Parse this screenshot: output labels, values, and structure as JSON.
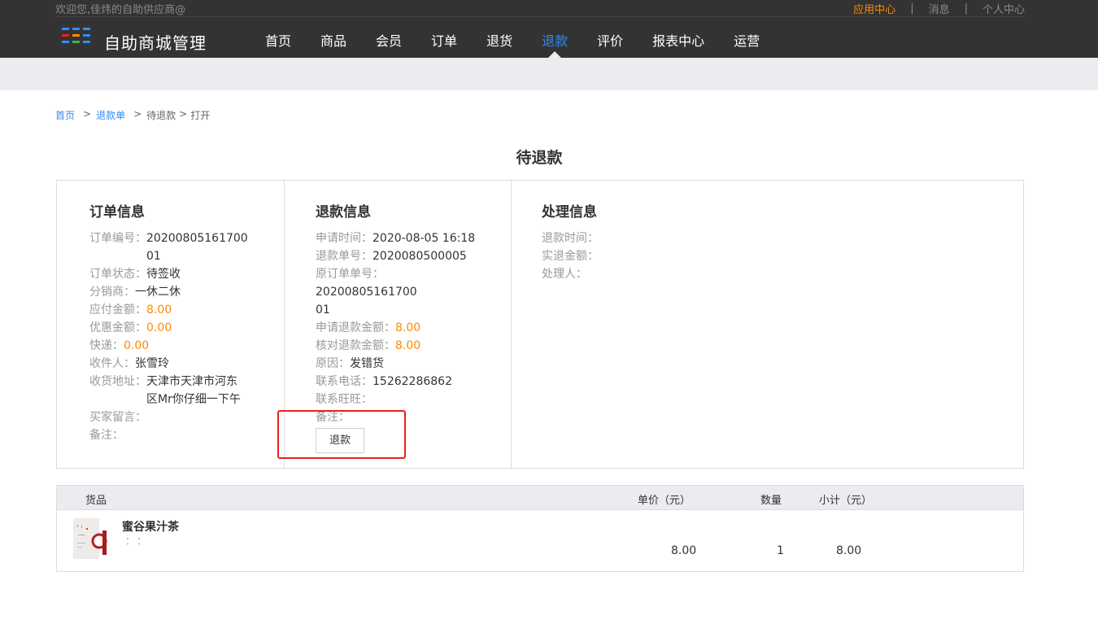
{
  "header": {
    "welcome": "欢迎您,佳炜的自助供应商@",
    "links": [
      {
        "label": "应用中心",
        "active": true
      },
      {
        "label": "消息",
        "active": false
      },
      {
        "label": "个人中心",
        "active": false
      }
    ],
    "separator": "|",
    "brand": "自助商城管理",
    "nav": [
      {
        "label": "首页",
        "active": false
      },
      {
        "label": "商品",
        "active": false
      },
      {
        "label": "会员",
        "active": false
      },
      {
        "label": "订单",
        "active": false
      },
      {
        "label": "退货",
        "active": false
      },
      {
        "label": "退款",
        "active": true
      },
      {
        "label": "评价",
        "active": false
      },
      {
        "label": "报表中心",
        "active": false
      },
      {
        "label": "运营",
        "active": false
      }
    ]
  },
  "breadcrumb": {
    "home": "首页",
    "refund_list": "退款单",
    "sep": ">",
    "pending": "待退款",
    "open": "打开"
  },
  "page_title": "待退款",
  "order_info": {
    "title": "订单信息",
    "order_no_label": "订单编号：",
    "order_no_line1": "20200805161700",
    "order_no_line2": "01",
    "status_label": "订单状态：",
    "status": "待签收",
    "distributor_label": "分销商：",
    "distributor": "一休二休",
    "payable_label": "应付金额：",
    "payable": "8.00",
    "discount_label": "优惠金额：",
    "discount": "0.00",
    "shipping_label": "快递：",
    "shipping": "0.00",
    "receiver_label": "收件人：",
    "receiver": "张雪玲",
    "address_label": "收货地址：",
    "address_line1": "天津市天津市河东",
    "address_line2": "区Mr你仔细一下午",
    "buyer_note_label": "买家留言：",
    "remark_label": "备注："
  },
  "refund_info": {
    "title": "退款信息",
    "apply_time_label": "申请时间：",
    "apply_time": "2020-08-05 16:18",
    "refund_no_label": "退款单号：",
    "refund_no": "2020080500005",
    "orig_order_label": "原订单单号：",
    "orig_order_line1": "20200805161700",
    "orig_order_line2": "01",
    "apply_amount_label": "申请退款金额：",
    "apply_amount": "8.00",
    "verify_amount_label": "核对退款金额：",
    "verify_amount": "8.00",
    "reason_label": "原因：",
    "reason": "发错货",
    "phone_label": "联系电话：",
    "phone": "15262286862",
    "wangwang_label": "联系旺旺：",
    "remark_label": "备注：",
    "refund_button": "退款"
  },
  "process_info": {
    "title": "处理信息",
    "refund_time_label": "退款时间：",
    "actual_amount_label": "实退金额：",
    "handler_label": "处理人："
  },
  "goods": {
    "headers": {
      "goods": "货品",
      "unit_price": "单价（元）",
      "qty": "数量",
      "subtotal": "小计（元）"
    },
    "items": [
      {
        "name": "蜜谷果汁茶",
        "spec": "：：",
        "unit_price": "8.00",
        "qty": "1",
        "subtotal": "8.00"
      }
    ]
  },
  "colors": {
    "accent_blue": "#2f8df5",
    "accent_orange": "#ff8a00",
    "highlight_red": "#e8201b",
    "header_bg": "#333333"
  }
}
